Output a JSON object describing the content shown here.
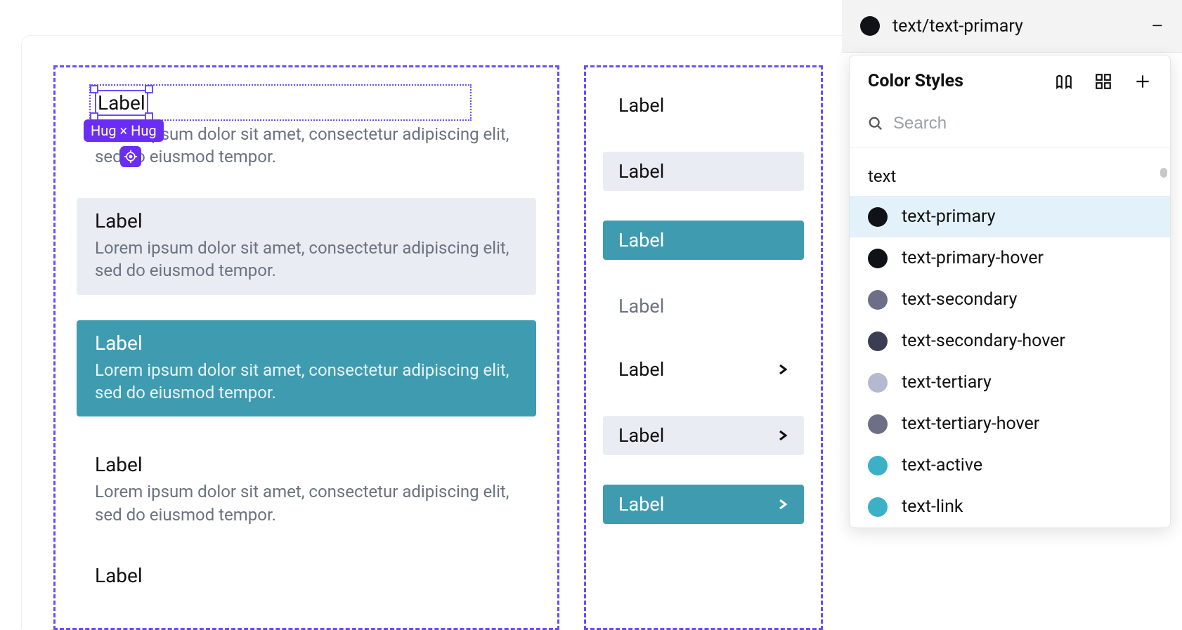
{
  "selection": {
    "label": "Label",
    "size_badge": "Hug × Hug",
    "body": "Lorem ipsum dolor sit amet, consectetur adipiscing elit, sed do eiusmod tempor."
  },
  "cards": [
    {
      "label": "Label",
      "body": "Lorem ipsum dolor sit amet, consectetur adipiscing elit, sed do eiusmod tempor.",
      "variant": "grey"
    },
    {
      "label": "Label",
      "body": "Lorem ipsum dolor sit amet, consectetur adipiscing elit, sed do eiusmod tempor.",
      "variant": "teal"
    },
    {
      "label": "Label",
      "body": "Lorem ipsum dolor sit amet, consectetur adipiscing elit, sed do eiusmod tempor.",
      "variant": "plain"
    }
  ],
  "partial_card_label": "Label",
  "nav": [
    {
      "label": "Label",
      "variant": "plain",
      "chevron": false
    },
    {
      "label": "Label",
      "variant": "grey",
      "chevron": false
    },
    {
      "label": "Label",
      "variant": "teal",
      "chevron": false
    },
    {
      "label": "Label",
      "variant": "muted",
      "chevron": false
    },
    {
      "label": "Label",
      "variant": "plain",
      "chevron": true
    },
    {
      "label": "Label",
      "variant": "grey",
      "chevron": true
    },
    {
      "label": "Label",
      "variant": "teal",
      "chevron": true
    }
  ],
  "panel": {
    "current_style": "text/text-primary",
    "current_swatch": "#101218",
    "popover_title": "Color Styles",
    "search_placeholder": "Search",
    "group": "text",
    "styles": [
      {
        "name": "text-primary",
        "color": "#101218",
        "active": true
      },
      {
        "name": "text-primary-hover",
        "color": "#101218",
        "active": false
      },
      {
        "name": "text-secondary",
        "color": "#6c6f86",
        "active": false
      },
      {
        "name": "text-secondary-hover",
        "color": "#3b3e52",
        "active": false
      },
      {
        "name": "text-tertiary",
        "color": "#b5b8d1",
        "active": false
      },
      {
        "name": "text-tertiary-hover",
        "color": "#6c6f86",
        "active": false
      },
      {
        "name": "text-active",
        "color": "#3cb0c7",
        "active": false
      },
      {
        "name": "text-link",
        "color": "#3cb0c7",
        "active": false
      }
    ]
  }
}
